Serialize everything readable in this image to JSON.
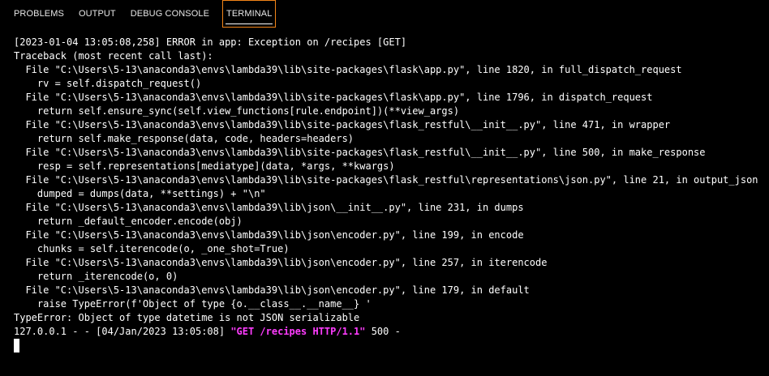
{
  "tabs": [
    {
      "label": "PROBLEMS",
      "active": false
    },
    {
      "label": "OUTPUT",
      "active": false
    },
    {
      "label": "DEBUG CONSOLE",
      "active": false
    },
    {
      "label": "TERMINAL",
      "active": true
    }
  ],
  "colors": {
    "background": "#000000",
    "text": "#ffffff",
    "active_tab_border": "#f38518",
    "request_highlight": "#ff3cff"
  },
  "terminal": {
    "lines": [
      "[2023-01-04 13:05:08,258] ERROR in app: Exception on /recipes [GET]",
      "Traceback (most recent call last):",
      "  File \"C:\\Users\\5-13\\anaconda3\\envs\\lambda39\\lib\\site-packages\\flask\\app.py\", line 1820, in full_dispatch_request",
      "    rv = self.dispatch_request()",
      "  File \"C:\\Users\\5-13\\anaconda3\\envs\\lambda39\\lib\\site-packages\\flask\\app.py\", line 1796, in dispatch_request",
      "    return self.ensure_sync(self.view_functions[rule.endpoint])(**view_args)",
      "  File \"C:\\Users\\5-13\\anaconda3\\envs\\lambda39\\lib\\site-packages\\flask_restful\\__init__.py\", line 471, in wrapper",
      "    return self.make_response(data, code, headers=headers)",
      "  File \"C:\\Users\\5-13\\anaconda3\\envs\\lambda39\\lib\\site-packages\\flask_restful\\__init__.py\", line 500, in make_response",
      "    resp = self.representations[mediatype](data, *args, **kwargs)",
      "  File \"C:\\Users\\5-13\\anaconda3\\envs\\lambda39\\lib\\site-packages\\flask_restful\\representations\\json.py\", line 21, in output_json",
      "    dumped = dumps(data, **settings) + \"\\n\"",
      "  File \"C:\\Users\\5-13\\anaconda3\\envs\\lambda39\\lib\\json\\__init__.py\", line 231, in dumps",
      "    return _default_encoder.encode(obj)",
      "  File \"C:\\Users\\5-13\\anaconda3\\envs\\lambda39\\lib\\json\\encoder.py\", line 199, in encode",
      "    chunks = self.iterencode(o, _one_shot=True)",
      "  File \"C:\\Users\\5-13\\anaconda3\\envs\\lambda39\\lib\\json\\encoder.py\", line 257, in iterencode",
      "    return _iterencode(o, 0)",
      "  File \"C:\\Users\\5-13\\anaconda3\\envs\\lambda39\\lib\\json\\encoder.py\", line 179, in default",
      "    raise TypeError(f'Object of type {o.__class__.__name__} '",
      "TypeError: Object of type datetime is not JSON serializable"
    ],
    "access_log": {
      "prefix": "127.0.0.1 - - [04/Jan/2023 13:05:08] ",
      "request": "\"GET /recipes HTTP/1.1\"",
      "suffix": " 500 -"
    }
  }
}
